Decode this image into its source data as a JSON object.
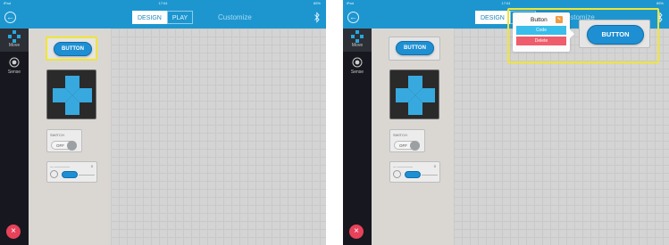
{
  "status_bar": {
    "carrier": "iPad",
    "time": "17:04",
    "battery": "85%"
  },
  "header": {
    "tabs": [
      {
        "label": "DESIGN",
        "active": true
      },
      {
        "label": "PLAY",
        "active": false
      }
    ],
    "title": "Customize"
  },
  "sidebar": {
    "items": [
      {
        "label": "Move",
        "icon": "dpad-icon",
        "active": true
      },
      {
        "label": "Sense",
        "icon": "sensor-icon",
        "active": false
      }
    ],
    "close_icon": "close-icon"
  },
  "palette": {
    "button_label": "BUTTON",
    "switch_label": "SWITCH",
    "switch_state": "OFF",
    "slider_label": "— —————",
    "slider_value": "0"
  },
  "popup": {
    "component_name": "Button",
    "code_label": "Code",
    "delete_label": "Delete"
  },
  "canvas": {
    "placed_button_label": "BUTTON"
  },
  "colors": {
    "accent_blue": "#1d96cf",
    "sidebar_dark": "#17181f",
    "selection_yellow": "#f2e532",
    "delete_red": "#ef5c6b",
    "code_cyan": "#39bdea",
    "close_red": "#e8425b"
  }
}
